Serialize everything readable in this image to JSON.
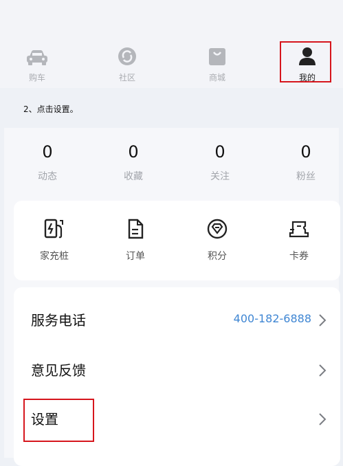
{
  "tabbar": {
    "items": [
      {
        "label": "购车",
        "icon": "car-icon"
      },
      {
        "label": "社区",
        "icon": "community-icon"
      },
      {
        "label": "商城",
        "icon": "shopping-bag-icon"
      },
      {
        "label": "我的",
        "icon": "person-icon",
        "active": true
      }
    ]
  },
  "caption": "2、点击设置。",
  "stats": [
    {
      "value": "0",
      "label": "动态"
    },
    {
      "value": "0",
      "label": "收藏"
    },
    {
      "value": "0",
      "label": "关注"
    },
    {
      "value": "0",
      "label": "粉丝"
    }
  ],
  "quick_actions": [
    {
      "label": "家充桩",
      "icon": "charging-pile-icon"
    },
    {
      "label": "订单",
      "icon": "order-icon"
    },
    {
      "label": "积分",
      "icon": "points-diamond-icon"
    },
    {
      "label": "卡券",
      "icon": "coupon-icon"
    }
  ],
  "menu": [
    {
      "label": "服务电话",
      "value": "400-182-6888"
    },
    {
      "label": "意见反馈"
    },
    {
      "label": "设置"
    }
  ],
  "colors": {
    "highlight": "#d6151c",
    "link": "#3f86d3",
    "inactive": "#a9abb0"
  }
}
